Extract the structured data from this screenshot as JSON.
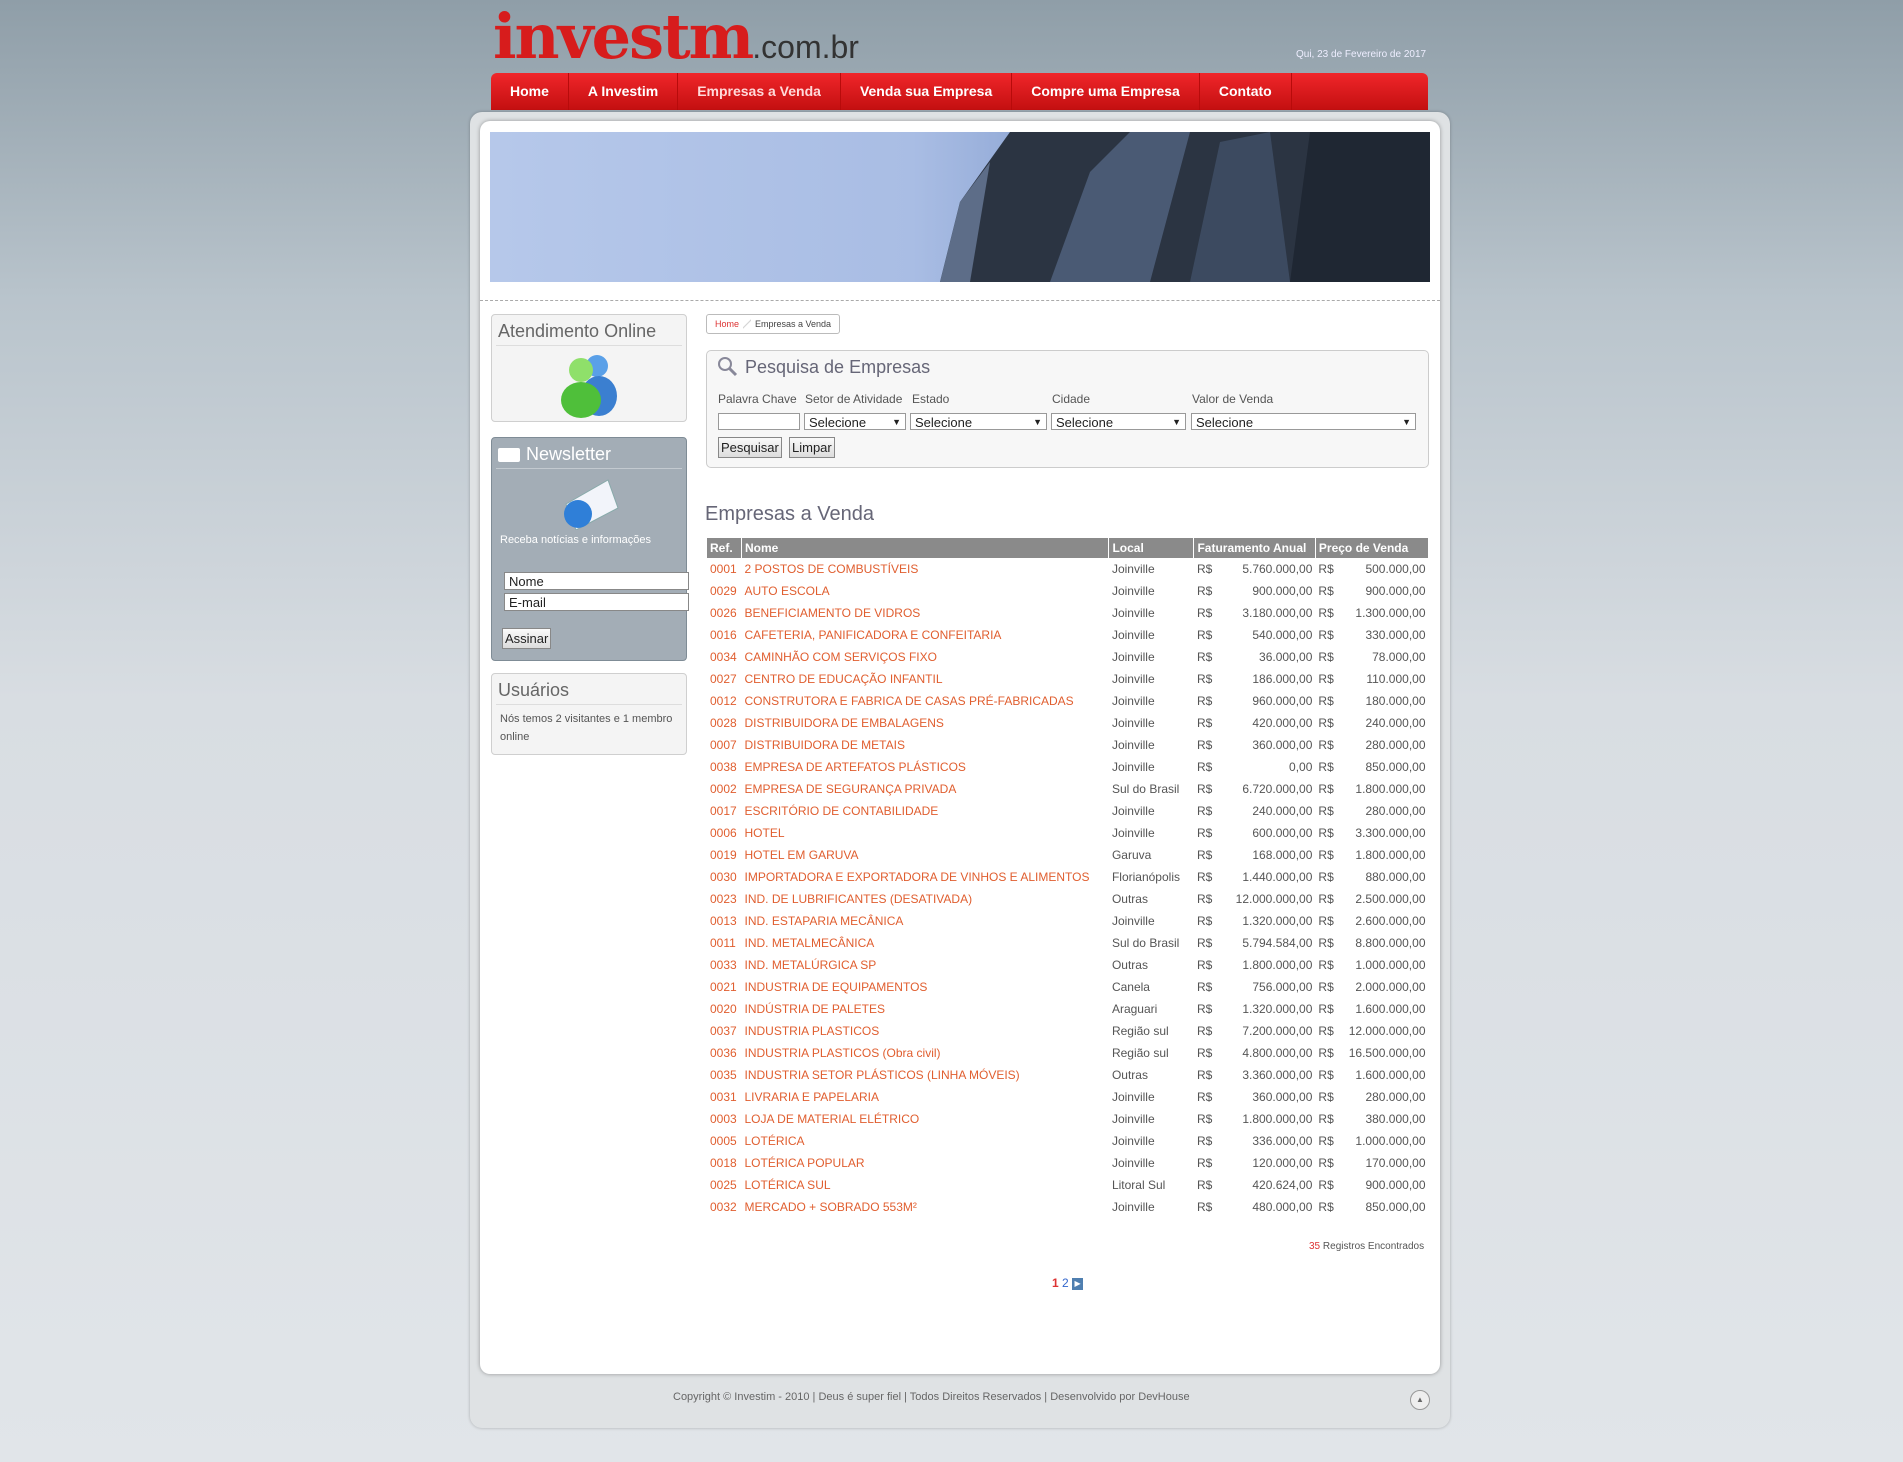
{
  "site": {
    "logo_main": "investm",
    "logo_tld": ".com.br",
    "date": "Qui, 23 de Fevereiro de 2017"
  },
  "nav": [
    "Home",
    "A Investim",
    "Empresas a Venda",
    "Venda sua Empresa",
    "Compre uma Empresa",
    "Contato"
  ],
  "sidebar": {
    "atendimento_title": "Atendimento Online",
    "newsletter": {
      "title": "Newsletter",
      "text": "Receba notícias e informações",
      "name_value": "Nome",
      "email_value": "E-mail",
      "button": "Assinar"
    },
    "usuarios": {
      "title": "Usuários",
      "text": "Nós temos 2 visitantes e 1 membro online"
    }
  },
  "breadcrumb": {
    "home": "Home",
    "current": "Empresas a Venda"
  },
  "search": {
    "title": "Pesquisa de Empresas",
    "labels": {
      "keyword": "Palavra Chave",
      "setor": "Setor de Atividade",
      "estado": "Estado",
      "cidade": "Cidade",
      "valor": "Valor de Venda"
    },
    "select_default": "Selecione",
    "btn_search": "Pesquisar",
    "btn_clear": "Limpar"
  },
  "listing": {
    "title": "Empresas a Venda",
    "columns": [
      "Ref.",
      "Nome",
      "Local",
      "Faturamento Anual",
      "Preço de Venda"
    ],
    "currency": "R$",
    "rows": [
      [
        "0001",
        "2 POSTOS DE COMBUSTÍVEIS",
        "Joinville",
        "5.760.000,00",
        "500.000,00"
      ],
      [
        "0029",
        "AUTO ESCOLA",
        "Joinville",
        "900.000,00",
        "900.000,00"
      ],
      [
        "0026",
        "BENEFICIAMENTO DE VIDROS",
        "Joinville",
        "3.180.000,00",
        "1.300.000,00"
      ],
      [
        "0016",
        "CAFETERIA, PANIFICADORA E CONFEITARIA",
        "Joinville",
        "540.000,00",
        "330.000,00"
      ],
      [
        "0034",
        "CAMINHÃO COM SERVIÇOS FIXO",
        "Joinville",
        "36.000,00",
        "78.000,00"
      ],
      [
        "0027",
        "CENTRO DE EDUCAÇÃO INFANTIL",
        "Joinville",
        "186.000,00",
        "110.000,00"
      ],
      [
        "0012",
        "CONSTRUTORA E FABRICA DE CASAS PRÉ-FABRICADAS",
        "Joinville",
        "960.000,00",
        "180.000,00"
      ],
      [
        "0028",
        "DISTRIBUIDORA DE EMBALAGENS",
        "Joinville",
        "420.000,00",
        "240.000,00"
      ],
      [
        "0007",
        "DISTRIBUIDORA DE METAIS",
        "Joinville",
        "360.000,00",
        "280.000,00"
      ],
      [
        "0038",
        "EMPRESA DE ARTEFATOS PLÁSTICOS",
        "Joinville",
        "0,00",
        "850.000,00"
      ],
      [
        "0002",
        "EMPRESA DE SEGURANÇA PRIVADA",
        "Sul do Brasil",
        "6.720.000,00",
        "1.800.000,00"
      ],
      [
        "0017",
        "ESCRITÓRIO DE CONTABILIDADE",
        "Joinville",
        "240.000,00",
        "280.000,00"
      ],
      [
        "0006",
        "HOTEL",
        "Joinville",
        "600.000,00",
        "3.300.000,00"
      ],
      [
        "0019",
        "HOTEL EM GARUVA",
        "Garuva",
        "168.000,00",
        "1.800.000,00"
      ],
      [
        "0030",
        "IMPORTADORA E EXPORTADORA DE VINHOS E ALIMENTOS",
        "Florianópolis",
        "1.440.000,00",
        "880.000,00"
      ],
      [
        "0023",
        "IND. DE LUBRIFICANTES (DESATIVADA)",
        "Outras",
        "12.000.000,00",
        "2.500.000,00"
      ],
      [
        "0013",
        "IND. ESTAPARIA MECÂNICA",
        "Joinville",
        "1.320.000,00",
        "2.600.000,00"
      ],
      [
        "0011",
        "IND. METALMECÂNICA",
        "Sul do Brasil",
        "5.794.584,00",
        "8.800.000,00"
      ],
      [
        "0033",
        "IND. METALÚRGICA SP",
        "Outras",
        "1.800.000,00",
        "1.000.000,00"
      ],
      [
        "0021",
        "INDUSTRIA DE EQUIPAMENTOS",
        "Canela",
        "756.000,00",
        "2.000.000,00"
      ],
      [
        "0020",
        "INDÚSTRIA DE PALETES",
        "Araguari",
        "1.320.000,00",
        "1.600.000,00"
      ],
      [
        "0037",
        "INDUSTRIA PLASTICOS",
        "Região sul",
        "7.200.000,00",
        "12.000.000,00"
      ],
      [
        "0036",
        "INDUSTRIA PLASTICOS (Obra civil)",
        "Região sul",
        "4.800.000,00",
        "16.500.000,00"
      ],
      [
        "0035",
        "INDUSTRIA SETOR PLÁSTICOS (LINHA MÓVEIS)",
        "Outras",
        "3.360.000,00",
        "1.600.000,00"
      ],
      [
        "0031",
        "LIVRARIA E PAPELARIA",
        "Joinville",
        "360.000,00",
        "280.000,00"
      ],
      [
        "0003",
        "LOJA DE MATERIAL ELÉTRICO",
        "Joinville",
        "1.800.000,00",
        "380.000,00"
      ],
      [
        "0005",
        "LOTÉRICA",
        "Joinville",
        "336.000,00",
        "1.000.000,00"
      ],
      [
        "0018",
        "LOTÉRICA POPULAR",
        "Joinville",
        "120.000,00",
        "170.000,00"
      ],
      [
        "0025",
        "LOTÉRICA SUL",
        "Litoral Sul",
        "420.624,00",
        "900.000,00"
      ],
      [
        "0032",
        "MERCADO + SOBRADO 553M²",
        "Joinville",
        "480.000,00",
        "850.000,00"
      ]
    ],
    "count_number": "35",
    "count_text": "Registros Encontrados",
    "pages": [
      "1",
      "2"
    ]
  },
  "footer": "Copyright © Investim - 2010 | Deus é super fiel | Todos Direitos Reservados | Desenvolvido por DevHouse",
  "colors": {
    "brand_red": "#d71c1c",
    "link_orange": "#e05e2f",
    "header_gray": "#8a8a8a"
  }
}
